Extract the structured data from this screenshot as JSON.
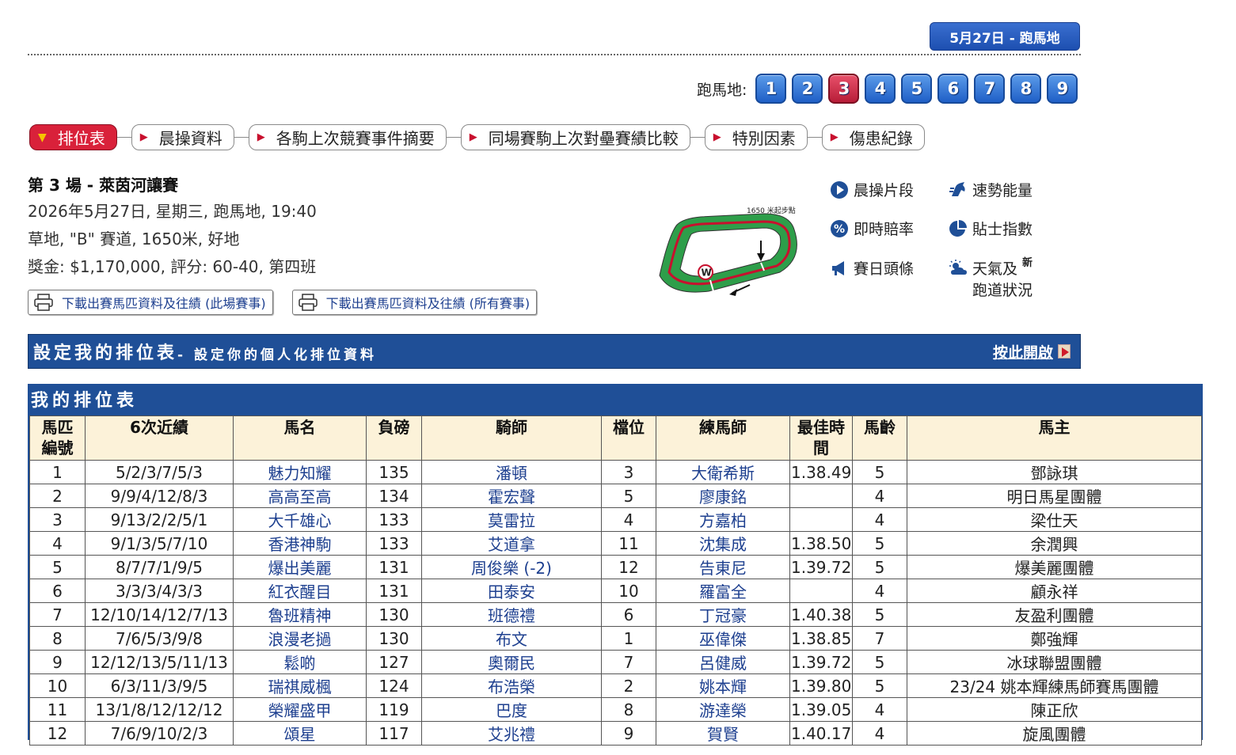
{
  "meeting_pill": "5月27日 - 跑馬地",
  "venue": {
    "label": "跑馬地:",
    "races": [
      "1",
      "2",
      "3",
      "4",
      "5",
      "6",
      "7",
      "8",
      "9"
    ],
    "active_race": "3"
  },
  "tabs": [
    {
      "label": "排位表",
      "active": true
    },
    {
      "label": "晨操資料",
      "active": false
    },
    {
      "label": "各駒上次競賽事件摘要",
      "active": false
    },
    {
      "label": "同場賽駒上次對壘賽績比較",
      "active": false
    },
    {
      "label": "特別因素",
      "active": false
    },
    {
      "label": "傷患紀錄",
      "active": false
    }
  ],
  "race": {
    "title": "第 3 場 - 萊茵河讓賽",
    "line1": "2026年5月27日, 星期三, 跑馬地, 19:40",
    "line2": "草地, \"B\" 賽道, 1650米, 好地",
    "line3": "獎金: $1,170,000, 評分: 60-40, 第四班"
  },
  "downloads": {
    "this_race": "下載出賽馬匹資料及往績 (此場賽事)",
    "all_races": "下載出賽馬匹資料及往績 (所有賽事)"
  },
  "track_map": {
    "label": "1650 米起步點"
  },
  "tools": {
    "trackwork_clips": "晨操片段",
    "speed_energy": "速勢能量",
    "live_odds": "即時賠率",
    "tips_index": "貼士指數",
    "raceday_news": "賽日頭條",
    "weather": "天氣及",
    "weather_2": "跑道狀況",
    "new_badge": "新"
  },
  "setup": {
    "title": "設定我的排位表",
    "subtitle": "- 設定你的個人化排位資料",
    "open_link": "按此開啟"
  },
  "table": {
    "title": "我的排位表",
    "headers": {
      "no_1": "馬匹",
      "no_2": "編號",
      "form": "6次近績",
      "horse": "馬名",
      "weight": "負磅",
      "jockey": "騎師",
      "draw": "檔位",
      "trainer": "練馬師",
      "best_1": "最佳時",
      "best_2": "間",
      "age": "馬齡",
      "owner": "馬主"
    },
    "rows": [
      {
        "no": "1",
        "form": "5/2/3/7/5/3",
        "horse": "魅力知耀",
        "wt": "135",
        "jockey": "潘頓",
        "draw": "3",
        "trainer": "大衛希斯",
        "time": "1.38.49",
        "age": "5",
        "owner": "鄧詠琪"
      },
      {
        "no": "2",
        "form": "9/9/4/12/8/3",
        "horse": "高高至高",
        "wt": "134",
        "jockey": "霍宏聲",
        "draw": "5",
        "trainer": "廖康銘",
        "time": "",
        "age": "4",
        "owner": "明日馬星團體"
      },
      {
        "no": "3",
        "form": "9/13/2/2/5/1",
        "horse": "大千雄心",
        "wt": "133",
        "jockey": "莫雷拉",
        "draw": "4",
        "trainer": "方嘉柏",
        "time": "",
        "age": "4",
        "owner": "梁仕天"
      },
      {
        "no": "4",
        "form": "9/1/3/5/7/10",
        "horse": "香港神駒",
        "wt": "133",
        "jockey": "艾道拿",
        "draw": "11",
        "trainer": "沈集成",
        "time": "1.38.50",
        "age": "5",
        "owner": "余潤興"
      },
      {
        "no": "5",
        "form": "8/7/7/1/9/5",
        "horse": "爆出美麗",
        "wt": "131",
        "jockey": "周俊樂 (-2)",
        "draw": "12",
        "trainer": "告東尼",
        "time": "1.39.72",
        "age": "5",
        "owner": "爆美麗團體"
      },
      {
        "no": "6",
        "form": "3/3/3/4/3/3",
        "horse": "紅衣醒目",
        "wt": "131",
        "jockey": "田泰安",
        "draw": "10",
        "trainer": "羅富全",
        "time": "",
        "age": "4",
        "owner": "顧永祥"
      },
      {
        "no": "7",
        "form": "12/10/14/12/7/13",
        "horse": "魯班精神",
        "wt": "130",
        "jockey": "班德禮",
        "draw": "6",
        "trainer": "丁冠豪",
        "time": "1.40.38",
        "age": "5",
        "owner": "友盈利團體"
      },
      {
        "no": "8",
        "form": "7/6/5/3/9/8",
        "horse": "浪漫老撾",
        "wt": "130",
        "jockey": "布文",
        "draw": "1",
        "trainer": "巫偉傑",
        "time": "1.38.85",
        "age": "7",
        "owner": "鄭強輝"
      },
      {
        "no": "9",
        "form": "12/12/13/5/11/13",
        "horse": "鬆啲",
        "wt": "127",
        "jockey": "奧爾民",
        "draw": "7",
        "trainer": "呂健威",
        "time": "1.39.72",
        "age": "5",
        "owner": "冰球聯盟團體"
      },
      {
        "no": "10",
        "form": "6/3/11/3/9/5",
        "horse": "瑞祺威楓",
        "wt": "124",
        "jockey": "布浩榮",
        "draw": "2",
        "trainer": "姚本輝",
        "time": "1.39.80",
        "age": "5",
        "owner": "23/24 姚本輝練馬師賽馬團體"
      },
      {
        "no": "11",
        "form": "13/1/8/12/12/12",
        "horse": "榮耀盛甲",
        "wt": "119",
        "jockey": "巴度",
        "draw": "8",
        "trainer": "游達榮",
        "time": "1.39.05",
        "age": "4",
        "owner": "陳正欣"
      },
      {
        "no": "12",
        "form": "7/6/9/10/2/3",
        "horse": "頌星",
        "wt": "117",
        "jockey": "艾兆禮",
        "draw": "9",
        "trainer": "賀賢",
        "time": "1.40.17",
        "age": "4",
        "owner": "旋風團體"
      }
    ]
  }
}
